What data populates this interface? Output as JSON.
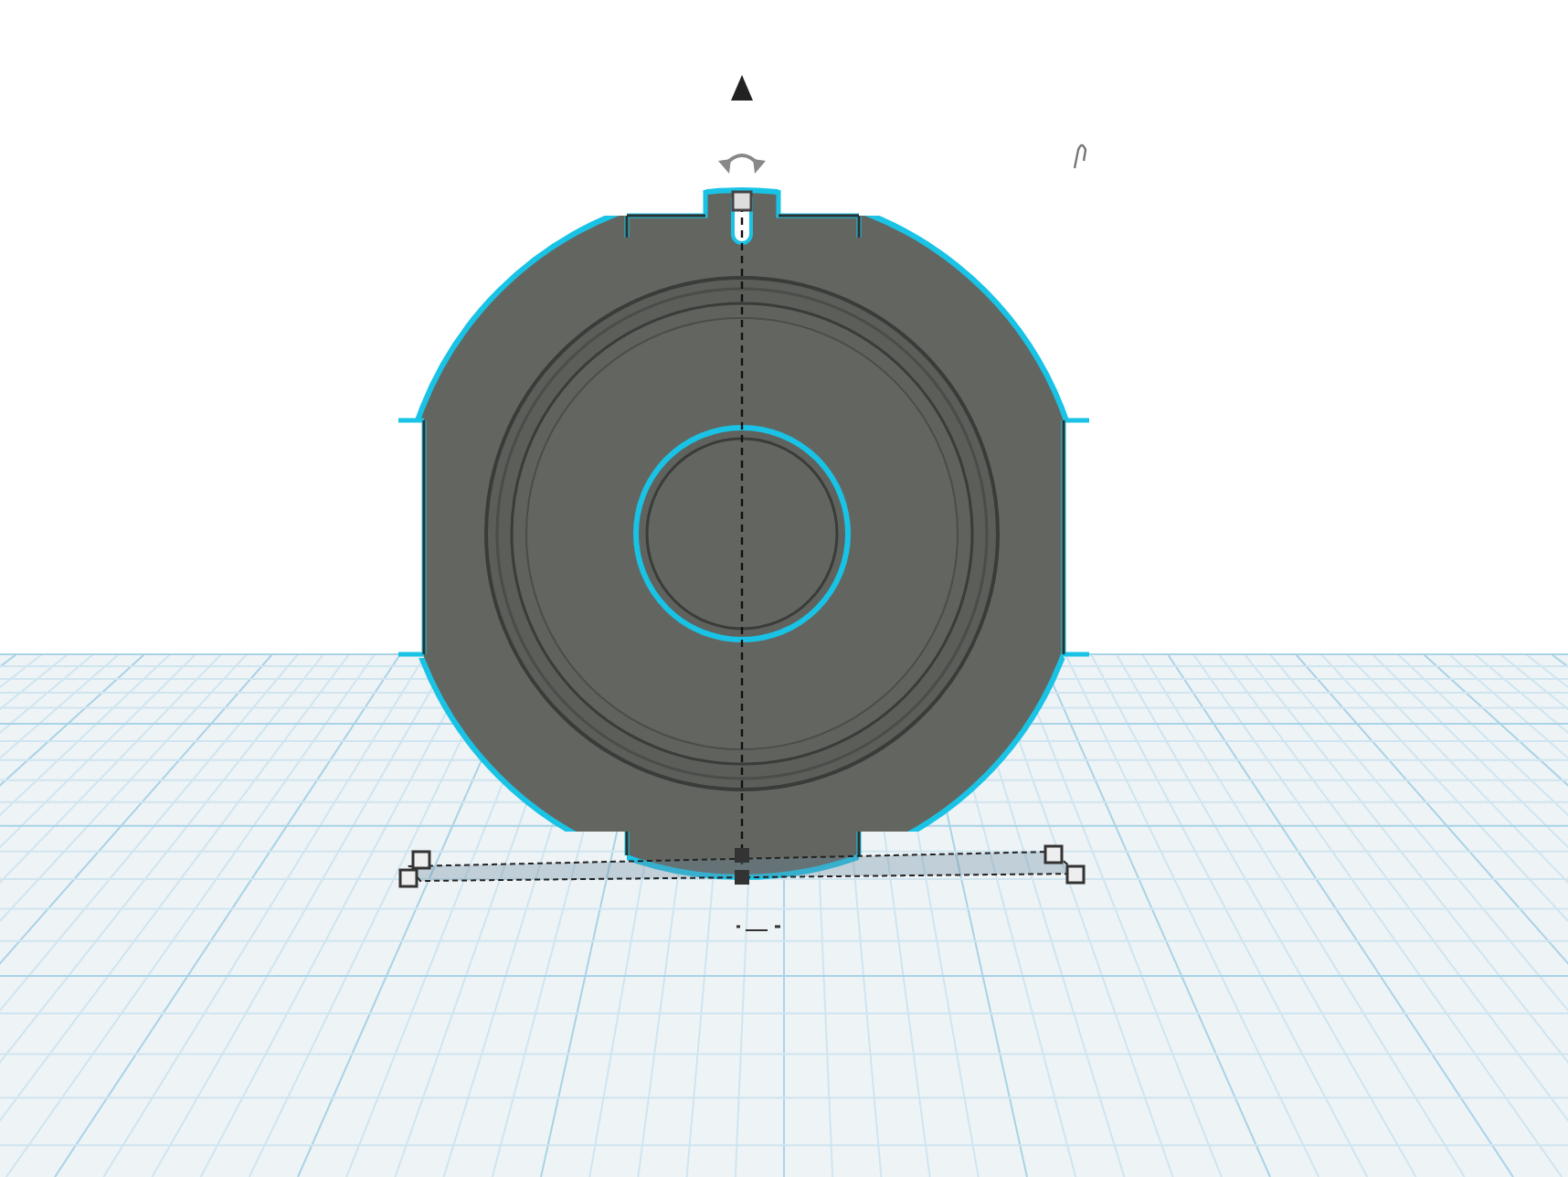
{
  "part": {
    "selected": true
  }
}
